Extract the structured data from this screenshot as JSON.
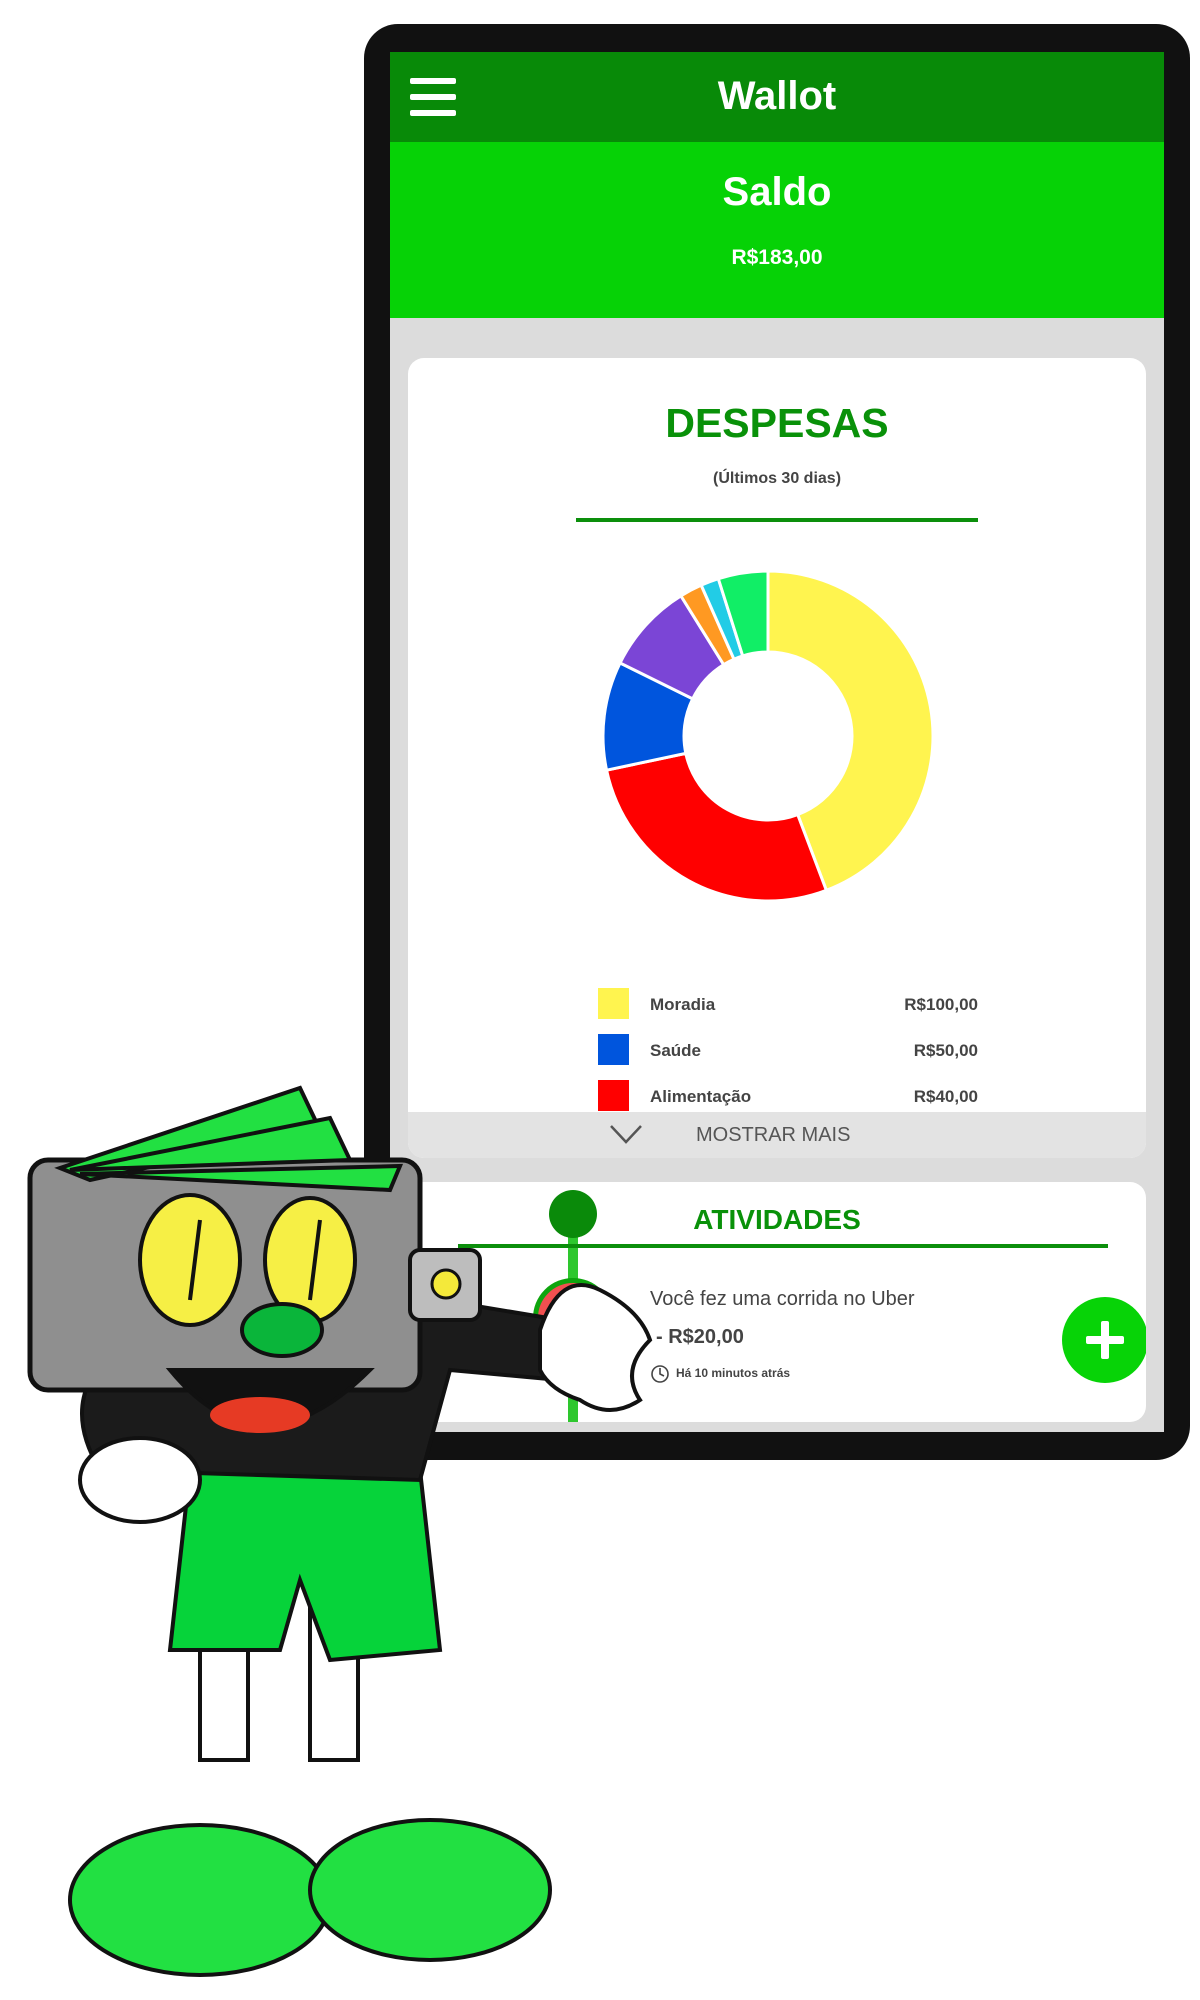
{
  "app": {
    "title": "Wallot"
  },
  "balance": {
    "label": "Saldo",
    "value": "R$183,00"
  },
  "expenses": {
    "title": "DESPESAS",
    "subtitle": "(Últimos 30 dias)",
    "show_more_label": "MOSTRAR MAIS",
    "legend": [
      {
        "label": "Moradia",
        "value": "R$100,00",
        "color": "#fff44f"
      },
      {
        "label": "Saúde",
        "value": "R$50,00",
        "color": "#0055dd"
      },
      {
        "label": "Alimentação",
        "value": "R$40,00",
        "color": "#ff0000"
      }
    ]
  },
  "chart_data": {
    "type": "pie",
    "title": "DESPESAS",
    "subtitle": "(Últimos 30 dias)",
    "donut": true,
    "values": [
      100,
      62,
      24,
      20,
      5,
      4,
      11
    ],
    "colors": [
      "#fff44f",
      "#ff0000",
      "#0055dd",
      "#7b45d6",
      "#ff9922",
      "#22cce6",
      "#11ee66"
    ],
    "labels": [
      "Moradia",
      "Alimentação",
      "Saúde",
      "",
      "",
      "",
      ""
    ]
  },
  "activities": {
    "title": "ATIVIDADES",
    "items": [
      {
        "text": "Você fez uma corrida no Uber",
        "amount": "- R$20,00",
        "time": "Há 10 minutos atrás",
        "icon": "car-icon"
      }
    ]
  },
  "colors": {
    "appbar": "#088a08",
    "balance_bg": "#06d206",
    "accent": "#099109"
  }
}
